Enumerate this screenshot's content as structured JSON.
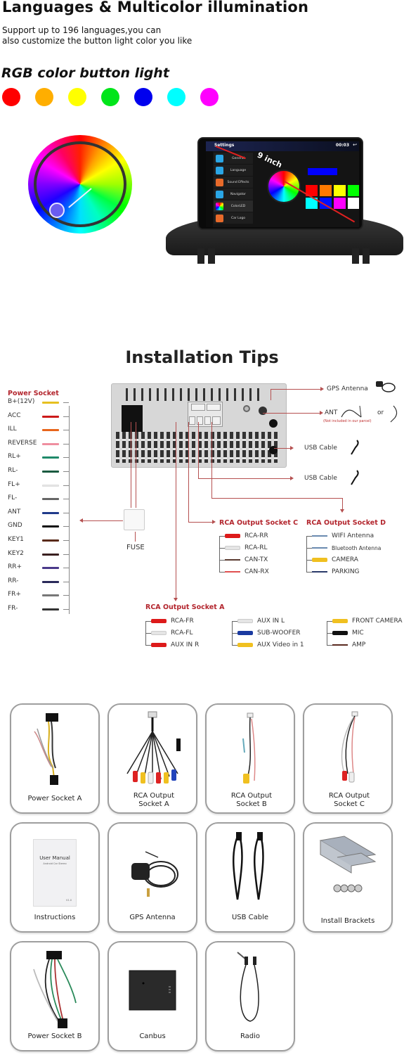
{
  "hero": {
    "title": "Languages & Multicolor illumination",
    "subtitle_line1": "Support up to 196 languages,you can",
    "subtitle_line2": "also customize the button light color you like",
    "rgb_title": "RGB color button light",
    "swatches": [
      "#ff0000",
      "#ffae00",
      "#ffff00",
      "#00e51a",
      "#0000ee",
      "#00ffff",
      "#ff00ff"
    ]
  },
  "headunit": {
    "screen_title": "Settings",
    "clock": "00:03",
    "size_label": "9 inch",
    "menu": [
      {
        "label": "General",
        "color": "#2aa6e6"
      },
      {
        "label": "Language",
        "color": "#2aa6e6"
      },
      {
        "label": "Sound Effects",
        "color": "#e86a2a"
      },
      {
        "label": "Navigator",
        "color": "#2aa6e6"
      },
      {
        "label": "ColorLED",
        "color": "#ffffff"
      },
      {
        "label": "Car Logo",
        "color": "#e86a2a"
      }
    ],
    "screen_colors": [
      "#ff0000",
      "#ff7a00",
      "#ffff00",
      "#00ff00",
      "#00ffff",
      "#0010ff",
      "#ff00ff",
      "#ffffff"
    ],
    "accent_color": "#0000ff"
  },
  "installation": {
    "title": "Installation Tips",
    "power_socket": {
      "title": "Power Socket",
      "wires": [
        {
          "label": "B+(12V)",
          "color": "#e6c020"
        },
        {
          "label": "ACC",
          "color": "#cc1a1a"
        },
        {
          "label": "ILL",
          "color": "#e8651c"
        },
        {
          "label": "REVERSE",
          "color": "#ef8fa0"
        },
        {
          "label": "RL+",
          "color": "#1f8a6a"
        },
        {
          "label": "RL-",
          "color": "#1a5a40"
        },
        {
          "label": "FL+",
          "color": "#e8e8e8"
        },
        {
          "label": "FL-",
          "color": "#666666"
        },
        {
          "label": "ANT",
          "color": "#1f3a8a"
        },
        {
          "label": "GND",
          "color": "#111111"
        },
        {
          "label": "KEY1",
          "color": "#5a2a1a"
        },
        {
          "label": "KEY2",
          "color": "#3a2020"
        },
        {
          "label": "RR+",
          "color": "#4a3a8a"
        },
        {
          "label": "RR-",
          "color": "#2a2a5a"
        },
        {
          "label": "FR+",
          "color": "#777777"
        },
        {
          "label": "FR-",
          "color": "#333333"
        }
      ]
    },
    "right_items": {
      "gps": "GPS Antenna",
      "ant": "ANT",
      "ant_note": "(Not included in our parcel)",
      "or": "or",
      "usb1": "USB Cable",
      "usb2": "USB Cable"
    },
    "fuse": "FUSE",
    "socket_c": {
      "title": "RCA Output Socket C",
      "items": [
        {
          "label": "RCA-RR",
          "kind": "rca",
          "color": "#dd1a1a"
        },
        {
          "label": "RCA-RL",
          "kind": "rca",
          "color": "#e5e5e5"
        },
        {
          "label": "CAN-TX",
          "kind": "wire",
          "color": "#5a3a30"
        },
        {
          "label": "CAN-RX",
          "kind": "wire",
          "color": "#e05050"
        }
      ]
    },
    "socket_d": {
      "title": "RCA Output Socket D",
      "items": [
        {
          "label": "WIFI Antenna",
          "kind": "wire",
          "color": "#6a8ab0"
        },
        {
          "label": "Bluetooth Antenna",
          "kind": "wire",
          "color": "#6a8ab0"
        },
        {
          "label": "CAMERA",
          "kind": "rca",
          "color": "#f0c020"
        },
        {
          "label": "PARKING",
          "kind": "wire",
          "color": "#2a3a6a"
        }
      ]
    },
    "socket_a": {
      "title": "RCA Output Socket A",
      "col1": [
        {
          "label": "RCA-FR",
          "kind": "rca",
          "color": "#dd1a1a"
        },
        {
          "label": "RCA-FL",
          "kind": "rca",
          "color": "#e5e5e5"
        },
        {
          "label": "AUX IN R",
          "kind": "rca",
          "color": "#dd1a1a"
        }
      ],
      "col2": [
        {
          "label": "AUX IN L",
          "kind": "rca",
          "color": "#e5e5e5"
        },
        {
          "label": "SUB-WOOFER",
          "kind": "rca",
          "color": "#1a3aa0"
        },
        {
          "label": "AUX Video in 1",
          "kind": "rca",
          "color": "#f0c020"
        }
      ],
      "col3": [
        {
          "label": "FRONT CAMERA",
          "kind": "rca",
          "color": "#f0c020"
        },
        {
          "label": "MIC",
          "kind": "rca",
          "color": "#111111"
        },
        {
          "label": "AMP",
          "kind": "wire",
          "color": "#5a2a20"
        }
      ]
    }
  },
  "accessories": [
    {
      "label": "Power Socket A"
    },
    {
      "label": "RCA Output Socket A"
    },
    {
      "label": "RCA Output Socket B"
    },
    {
      "label": "RCA Output Socket C"
    },
    {
      "label": "Instructions",
      "manual_title": "User Manual",
      "manual_sub": "Android Car Stereo",
      "manual_version": "V1.0"
    },
    {
      "label": "GPS Antenna"
    },
    {
      "label": "USB Cable"
    },
    {
      "label": "Install  Brackets"
    },
    {
      "label": "Power Socket B"
    },
    {
      "label": "Canbus"
    },
    {
      "label": "Radio"
    }
  ]
}
